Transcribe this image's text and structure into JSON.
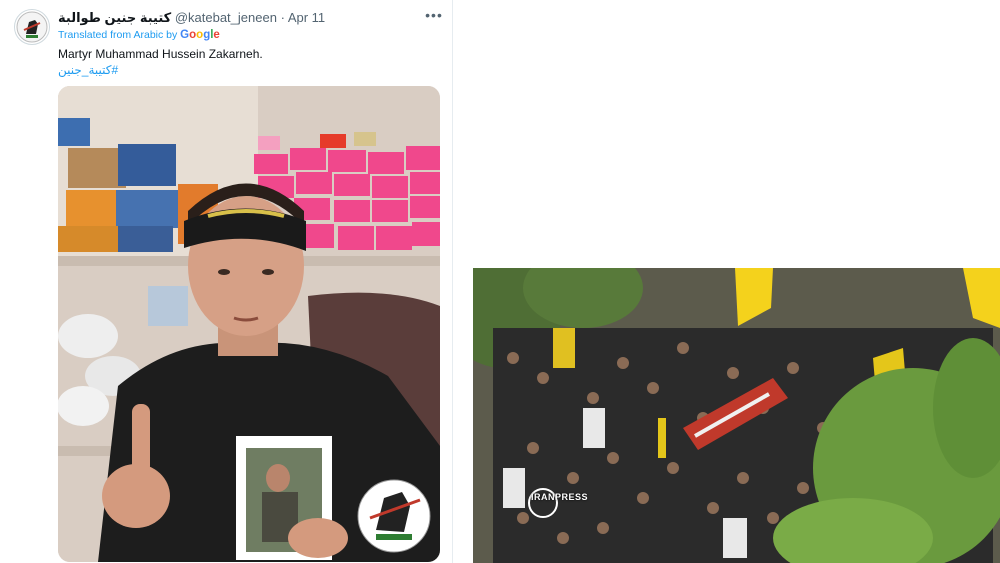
{
  "tweet": {
    "display_name": "كتيبة جنين طوالبة",
    "handle": "@katebat_jeneen",
    "separator": "·",
    "date": "Apr 11",
    "more_icon": "more-horizontal-icon",
    "translation": {
      "prefix": "Translated from Arabic by",
      "brand": "Google",
      "brand_colors": [
        "#4285f4",
        "#ea4335",
        "#fbbc05",
        "#4285f4",
        "#34a853",
        "#ea4335"
      ]
    },
    "text": "Martyr Muhammad Hussein Zakarneh.",
    "hashtag": "#كتيبة_جنين",
    "link_color": "#1d9bf0"
  },
  "photo2": {
    "watermark": "IRANPRESS"
  }
}
